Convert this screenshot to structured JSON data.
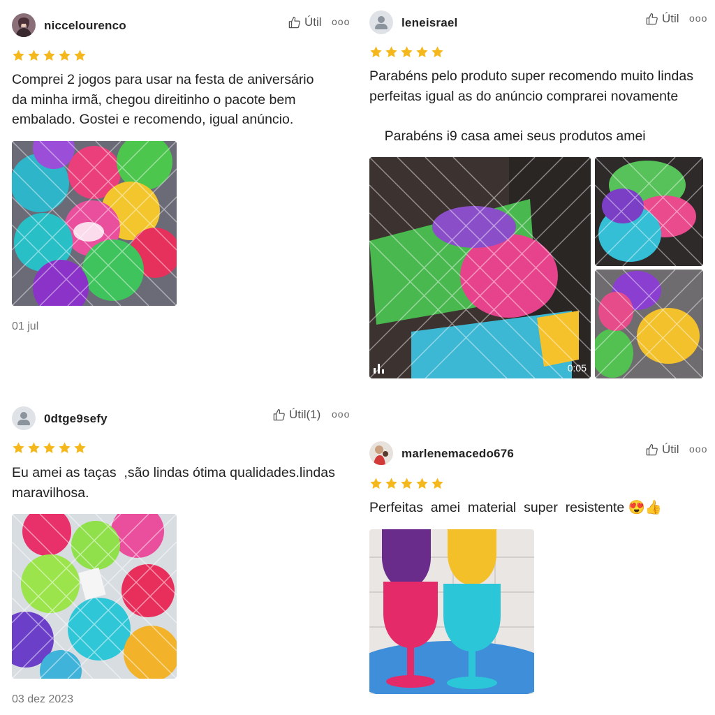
{
  "reviews": [
    {
      "username": "niccelourenco",
      "useful": "Útil",
      "more": "ooo",
      "rating": 5,
      "text": "Comprei 2 jogos para usar na festa de aniversário\nda minha irmã, chegou direitinho o pacote bem\nembalado. Gostei e recomendo, igual anúncio.",
      "date": "01 jul"
    },
    {
      "username": "leneisrael",
      "useful": "Útil",
      "more": "ooo",
      "rating": 5,
      "text": "Parabéns pelo produto super recomendo muito lindas\nperfeitas igual as do anúncio comprarei novamente\n\n    Parabéns i9 casa amei seus produtos amei",
      "video_duration": "0:05"
    },
    {
      "username": "0dtge9sefy",
      "useful": "Útil(1)",
      "more": "ooo",
      "rating": 5,
      "text": "Eu amei as taças  ,são lindas ótima qualidades.lindas\nmaravilhosa.",
      "date": "03 dez 2023"
    },
    {
      "username": "marlenemacedo676",
      "useful": "Útil",
      "more": "ooo",
      "rating": 5,
      "text": "Perfeitas  amei  material  super  resistente 😍👍"
    }
  ],
  "colors": {
    "star": "#f5b81c",
    "text": "#222222",
    "muted": "#777777"
  }
}
